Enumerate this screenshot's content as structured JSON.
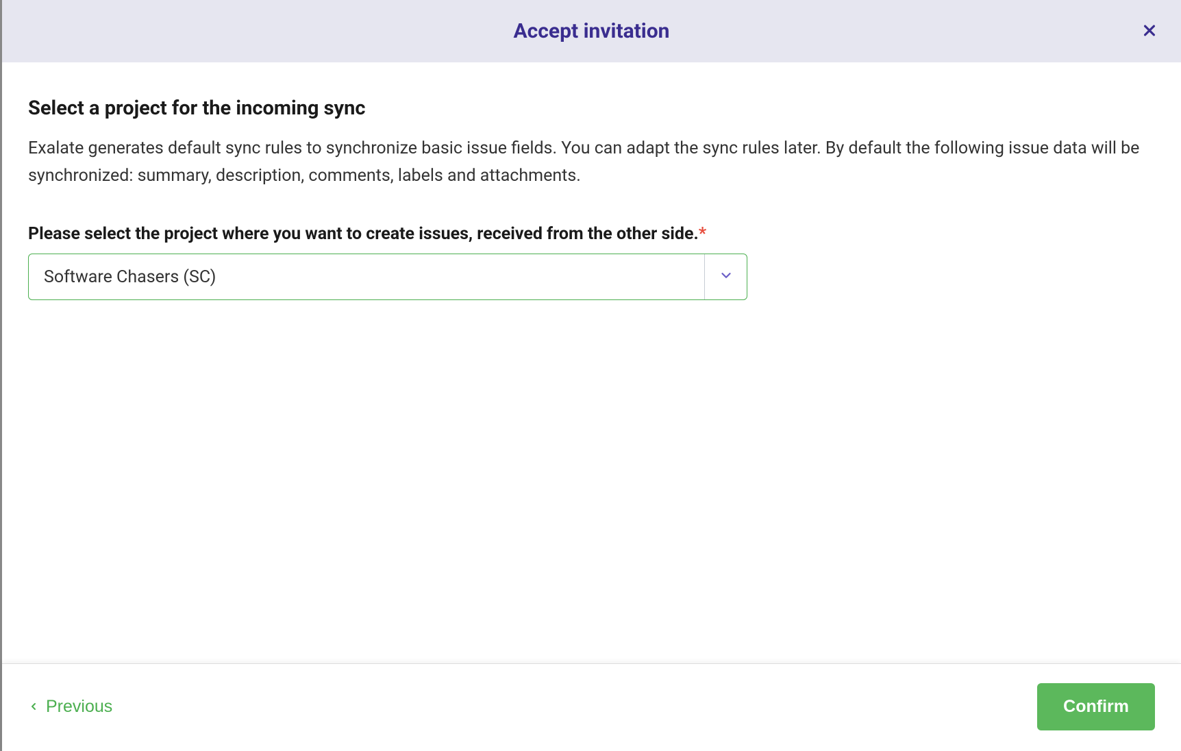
{
  "header": {
    "title": "Accept invitation"
  },
  "main": {
    "section_title": "Select a project for the incoming sync",
    "section_desc": "Exalate generates default sync rules to synchronize basic issue fields. You can adapt the sync rules later. By default the following issue data will be synchronized: summary, description, comments, labels and attachments.",
    "field_label": "Please select the project where you want to create issues, received from the other side.",
    "required_mark": "*",
    "select": {
      "value": "Software Chasers (SC)"
    }
  },
  "footer": {
    "previous_label": "Previous",
    "confirm_label": "Confirm"
  }
}
